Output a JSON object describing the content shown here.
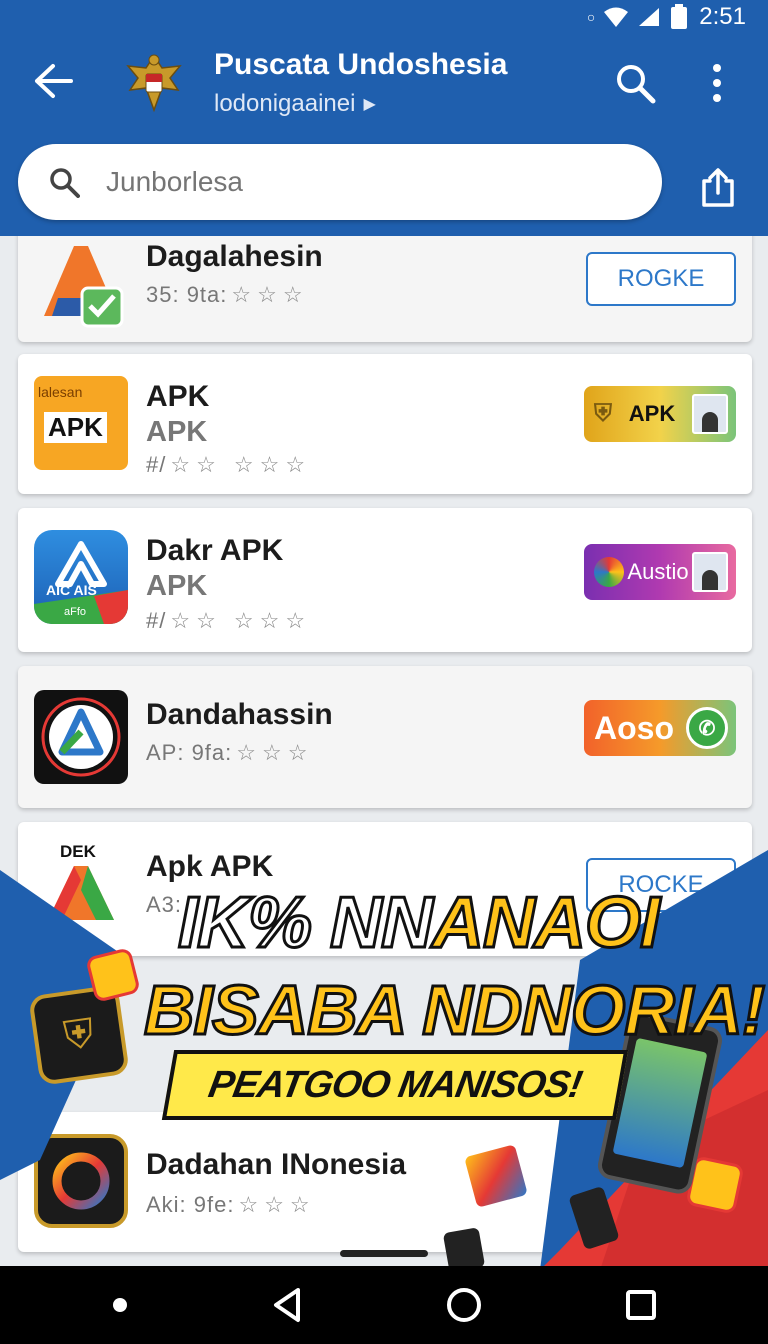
{
  "status_bar": {
    "time": "2:51"
  },
  "app_bar": {
    "title": "Puscata Undoshesia",
    "subtitle": "lodonigaainei",
    "search_placeholder": "Junborlesa"
  },
  "apps": [
    {
      "name": "Dagalahesin",
      "sub": "",
      "meta": "35: 9ta:",
      "stars": "☆☆☆",
      "button": "ROGKE",
      "button_style": "outline"
    },
    {
      "name": "APK",
      "sub": "APK",
      "meta": "#/",
      "stars": "☆☆ ☆☆☆",
      "button": "APK",
      "button_style": "gold",
      "icon_label": "APK",
      "icon_top": "lalesan"
    },
    {
      "name": "Dakr APK",
      "sub": "APK",
      "meta": "#/",
      "stars": "☆☆ ☆☆☆",
      "button": "Austio",
      "button_style": "purple",
      "icon_label": "AIC  AIS",
      "icon_badge": "aFfo"
    },
    {
      "name": "Dandahassin",
      "sub": "",
      "meta": "AP: 9fa:",
      "stars": "☆☆☆",
      "button": "Aoso",
      "button_style": "orange"
    },
    {
      "name": "Apk APK",
      "sub": "",
      "meta": "A3:",
      "stars": "",
      "button": "ROCKE",
      "button_style": "outline",
      "icon_top": "DEK"
    },
    {
      "name": "Dadahan INonesia",
      "sub": "",
      "meta": "Aki: 9fe:",
      "stars": "☆☆☆",
      "button": "",
      "button_style": "none"
    }
  ],
  "promo": {
    "line1_white": "IK% NN",
    "line1_yellow": "ANAOI",
    "line2": "BISABA NDNORIA!",
    "line3": "PEATGOO MANISOS!"
  },
  "colors": {
    "primary": "#1f5fae",
    "accent_outline": "#2d78c9",
    "promo_yellow": "#ffc21a",
    "promo_red": "#e53935"
  }
}
